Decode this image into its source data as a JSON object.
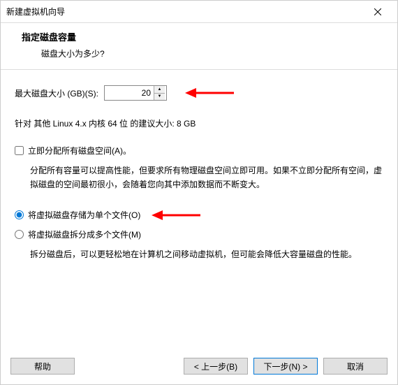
{
  "window": {
    "title": "新建虚拟机向导"
  },
  "header": {
    "title": "指定磁盘容量",
    "subtitle": "磁盘大小为多少?"
  },
  "size": {
    "label": "最大磁盘大小 (GB)(S):",
    "value": "20"
  },
  "recommendation": "针对 其他 Linux 4.x 内核 64 位 的建议大小: 8 GB",
  "allocate": {
    "label": "立即分配所有磁盘空间(A)。",
    "desc": "分配所有容量可以提高性能，但要求所有物理磁盘空间立即可用。如果不立即分配所有空间，虚拟磁盘的空间最初很小，会随着您向其中添加数据而不断变大。"
  },
  "storage": {
    "single": "将虚拟磁盘存储为单个文件(O)",
    "split": "将虚拟磁盘拆分成多个文件(M)",
    "split_desc": "拆分磁盘后，可以更轻松地在计算机之间移动虚拟机，但可能会降低大容量磁盘的性能。"
  },
  "buttons": {
    "help": "帮助",
    "back": "< 上一步(B)",
    "next": "下一步(N) >",
    "cancel": "取消"
  }
}
